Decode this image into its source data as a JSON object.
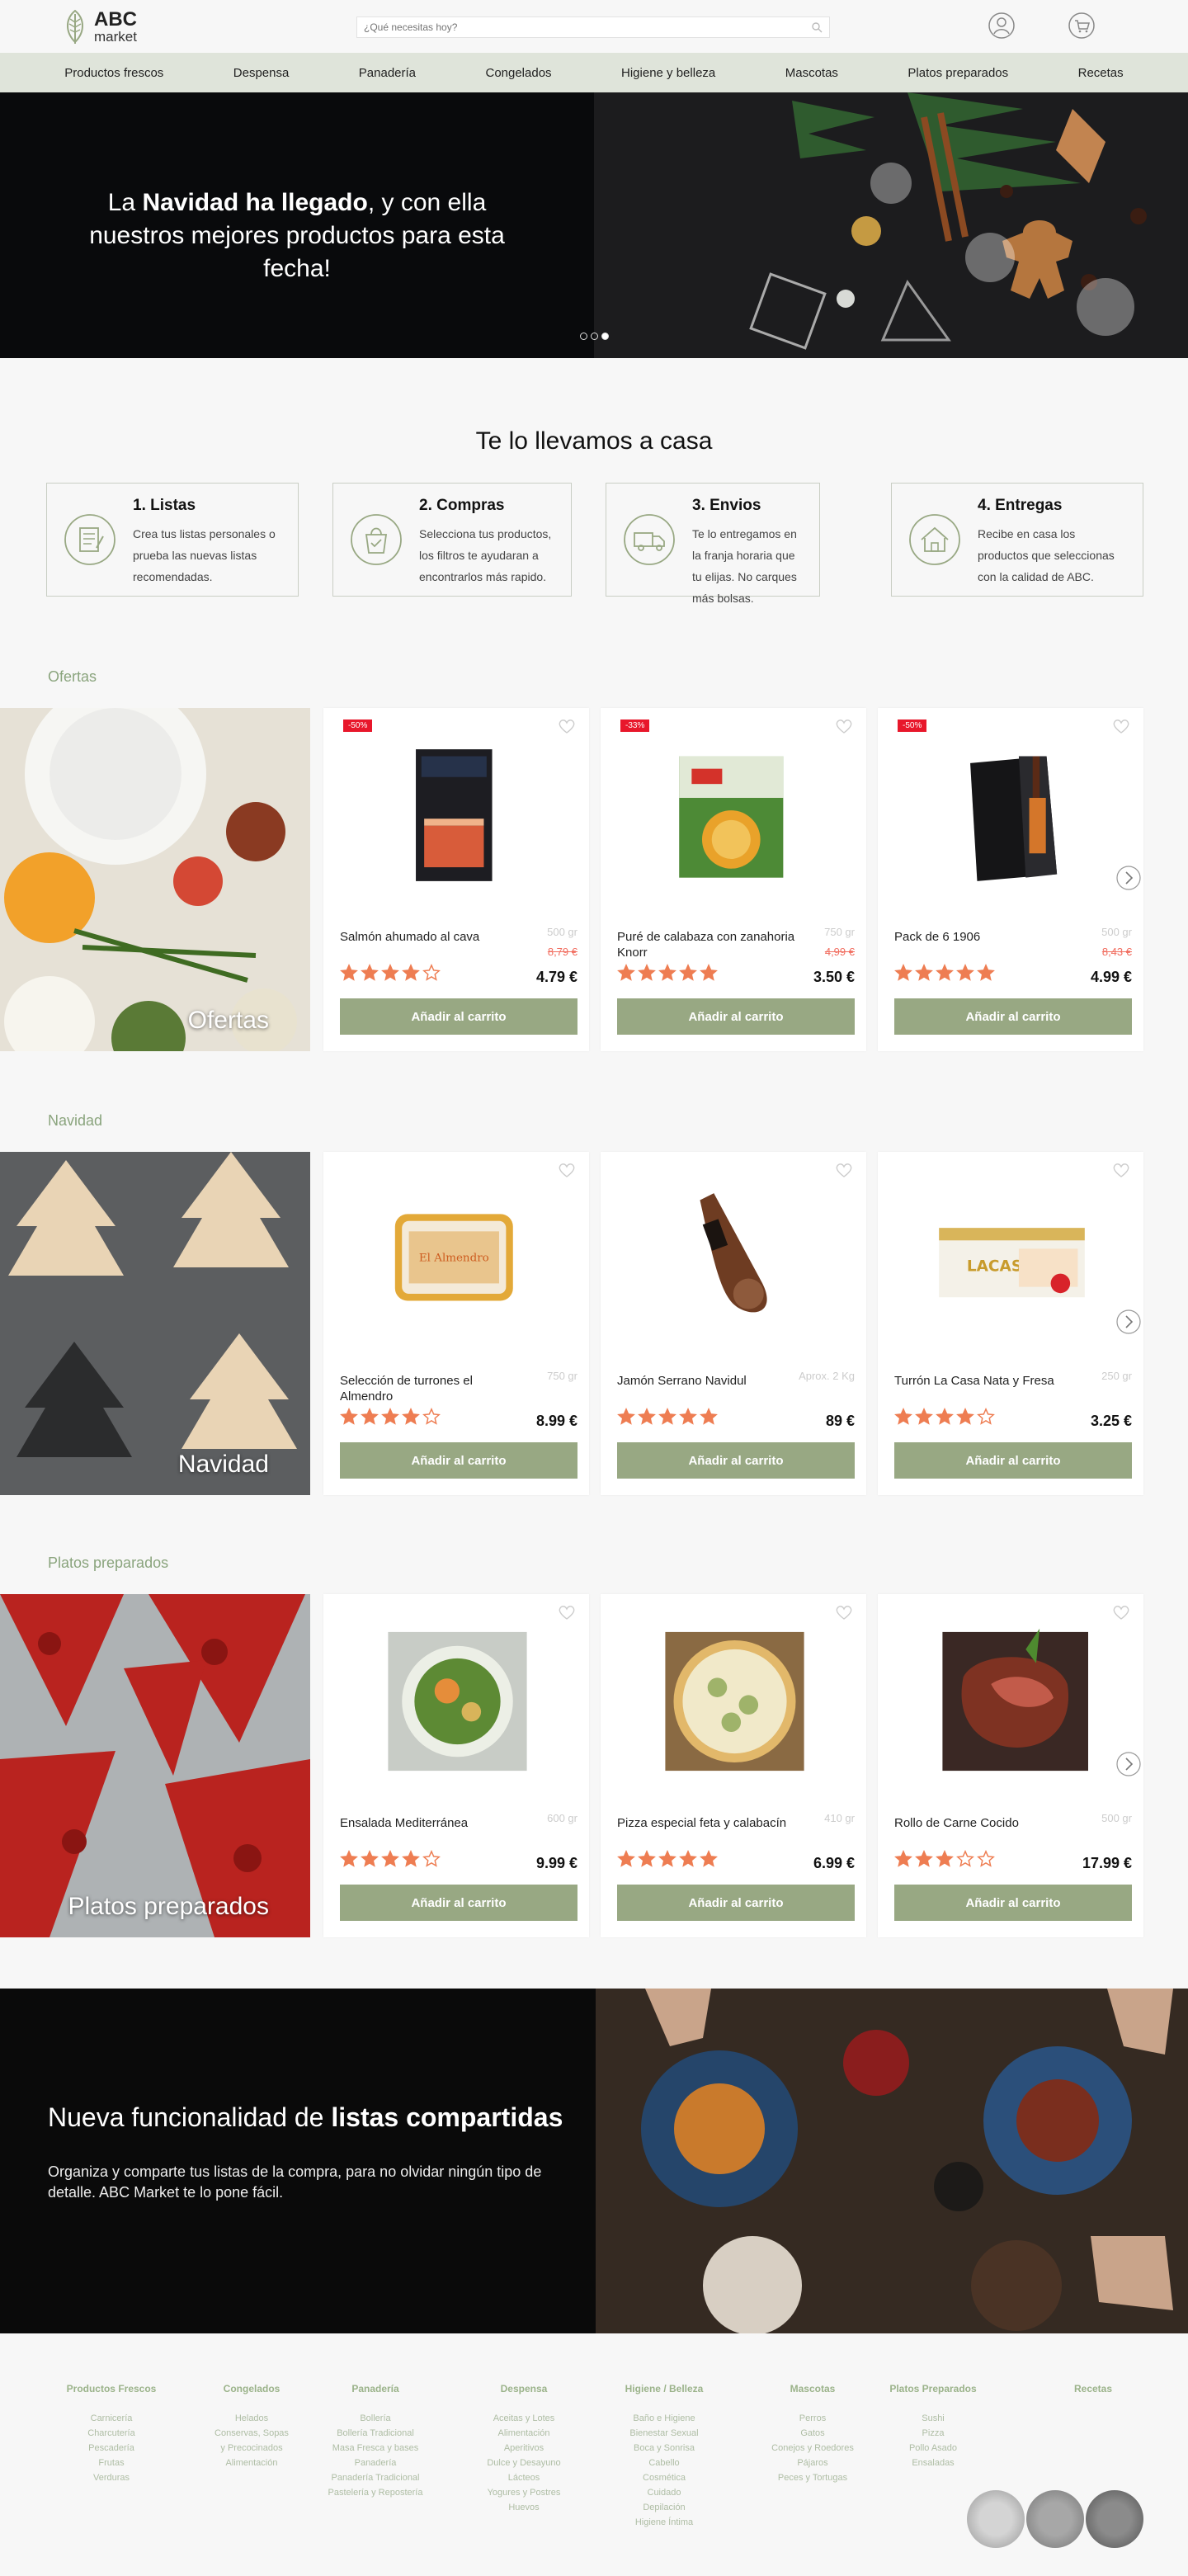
{
  "header": {
    "logo_top": "ABC",
    "logo_bottom": "market",
    "search_placeholder": "¿Qué necesitas hoy?"
  },
  "nav": [
    "Productos frescos",
    "Despensa",
    "Panadería",
    "Congelados",
    "Higiene y belleza",
    "Mascotas",
    "Platos preparados",
    "Recetas"
  ],
  "hero": {
    "pre": "La ",
    "bold": "Navidad ha llegado",
    "post": ", y con ella nuestros mejores productos para esta fecha!"
  },
  "steps": {
    "title": "Te lo llevamos a casa",
    "items": [
      {
        "title": "1. Listas",
        "text": "Crea tus listas personales o prueba las nuevas listas recomendadas.",
        "icon": "list-icon"
      },
      {
        "title": "2. Compras",
        "text": "Selecciona tus productos, los filtros te ayudaran a encontrarlos más rapido.",
        "icon": "shopping-bag-icon"
      },
      {
        "title": "3. Envios",
        "text": "Te lo entregamos en la franja horaria que tu elijas. No carques más bolsas.",
        "icon": "truck-icon"
      },
      {
        "title": "4. Entregas",
        "text": "Recibe en casa los productos que seleccionas con la calidad de ABC.",
        "icon": "house-icon"
      }
    ]
  },
  "add_label": "Añadir al carrito",
  "sections": [
    {
      "title": "Ofertas",
      "banner": "Ofertas",
      "products": [
        {
          "name": "Salmón ahumado al cava",
          "weight": "500 gr",
          "old": "8,79 €",
          "price": "4.79 €",
          "rating": 4,
          "badge": "-50%"
        },
        {
          "name": "Puré de calabaza con zanahoria Knorr",
          "weight": "750 gr",
          "old": "4,99 €",
          "price": "3.50 €",
          "rating": 5,
          "badge": "-33%"
        },
        {
          "name": "Pack de 6 1906",
          "weight": "500 gr",
          "old": "8,43 €",
          "price": "4.99 €",
          "rating": 5,
          "badge": "-50%"
        }
      ]
    },
    {
      "title": "Navidad",
      "banner": "Navidad",
      "products": [
        {
          "name": "Selección de turrones el Almendro",
          "weight": "750 gr",
          "old": "",
          "price": "8.99 €",
          "rating": 4,
          "badge": ""
        },
        {
          "name": "Jamón Serrano Navidul",
          "weight": "Aprox. 2 Kg",
          "old": "",
          "price": "89 €",
          "rating": 5,
          "badge": ""
        },
        {
          "name": "Turrón La Casa Nata y Fresa",
          "weight": "250 gr",
          "old": "",
          "price": "3.25 €",
          "rating": 4,
          "badge": ""
        }
      ]
    },
    {
      "title": "Platos preparados",
      "banner": "Platos preparados",
      "products": [
        {
          "name": "Ensalada Mediterránea",
          "weight": "600 gr",
          "old": "",
          "price": "9.99 €",
          "rating": 4,
          "badge": ""
        },
        {
          "name": "Pizza especial feta y calabacín",
          "weight": "410 gr",
          "old": "",
          "price": "6.99 €",
          "rating": 5,
          "badge": ""
        },
        {
          "name": "Rollo de Carne Cocido",
          "weight": "500 gr",
          "old": "",
          "price": "17.99 €",
          "rating": 3,
          "badge": ""
        }
      ]
    }
  ],
  "lists": {
    "pre": "Nueva funcionalidad de ",
    "bold": "listas compartidas",
    "text": "Organiza y comparte tus listas de la compra, para no olvidar ningún tipo de detalle. ABC Market te lo pone fácil."
  },
  "footer": [
    {
      "title": "Productos Frescos",
      "items": [
        "Carnicería",
        "Charcutería",
        "Pescadería",
        "Frutas",
        "Verduras"
      ]
    },
    {
      "title": "Congelados",
      "items": [
        "Helados",
        "Conservas, Sopas",
        "y Precocinados",
        "Alimentación"
      ]
    },
    {
      "title": "Panadería",
      "items": [
        "Bollería",
        "Bollería Tradicional",
        "Masa Fresca y bases",
        "Panadería",
        "Panadería Tradicional",
        "Pastelería y Repostería"
      ]
    },
    {
      "title": "Despensa",
      "items": [
        "Aceitas y Lotes",
        "Alimentación",
        "Aperitivos",
        "Dulce y Desayuno",
        "Lácteos",
        "Yogures y Postres",
        "Huevos"
      ]
    },
    {
      "title": "Higiene / Belleza",
      "items": [
        "Baño e Higiene",
        "Bienestar Sexual",
        "Boca y Sonrisa",
        "Cabello",
        "Cosmética",
        "Cuidado",
        "Depilación",
        "Higiene Íntima"
      ]
    },
    {
      "title": "Mascotas",
      "items": [
        "Perros",
        "Gatos",
        "Conejos y Roedores",
        "Pájaros",
        "Peces y Tortugas"
      ]
    },
    {
      "title": "Platos Preparados",
      "items": [
        "Sushi",
        "Pizza",
        "Pollo Asado",
        "Ensaladas"
      ]
    },
    {
      "title": "Recetas",
      "items": []
    }
  ],
  "colors": {
    "accent": "#98a883",
    "section_title": "#8aa47d",
    "nav_bg": "#dfe4da",
    "star": "#ee7d52",
    "discount": "#e8172b"
  }
}
